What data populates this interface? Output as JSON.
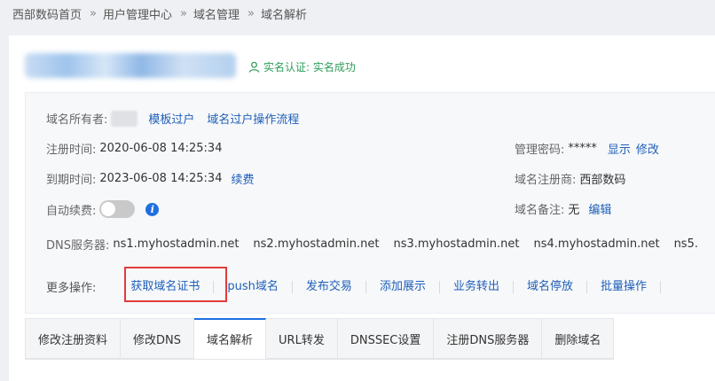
{
  "breadcrumb": {
    "items": [
      "西部数码首页",
      "用户管理中心",
      "域名管理",
      "域名解析"
    ],
    "separator": "»"
  },
  "header": {
    "verify_text": "实名认证: 实名成功"
  },
  "info": {
    "owner_label": "域名所有者:",
    "transfer_template": "模板过户",
    "transfer_flow": "域名过户操作流程",
    "reg_time_label": "注册时间:",
    "reg_time_value": "2020-06-08 14:25:34",
    "exp_time_label": "到期时间:",
    "exp_time_value": "2023-06-08 14:25:34",
    "renew": "续费",
    "auto_renew_label": "自动续费:",
    "auto_renew_on": false,
    "password_label": "管理密码:",
    "password_value": "*****",
    "show": "显示",
    "modify": "修改",
    "registrar_label": "域名注册商:",
    "registrar_value": "西部数码",
    "remark_label": "域名备注:",
    "remark_value": "无",
    "edit": "编辑",
    "dns_label": "DNS服务器:",
    "dns_servers": [
      "ns1.myhostadmin.net",
      "ns2.myhostadmin.net",
      "ns3.myhostadmin.net",
      "ns4.myhostadmin.net",
      "ns5."
    ]
  },
  "actions": {
    "label": "更多操作:",
    "items": [
      "获取域名证书",
      "push域名",
      "发布交易",
      "添加展示",
      "业务转出",
      "域名停放",
      "批量操作"
    ]
  },
  "tabs": {
    "items": [
      "修改注册资料",
      "修改DNS",
      "域名解析",
      "URL转发",
      "DNSSEC设置",
      "注册DNS服务器",
      "删除域名"
    ],
    "active_index": 2
  },
  "colors": {
    "link": "#1f5fb8",
    "success": "#2e9e5a",
    "highlight": "#e23b3b",
    "tab_active": "#1f6fe0"
  }
}
